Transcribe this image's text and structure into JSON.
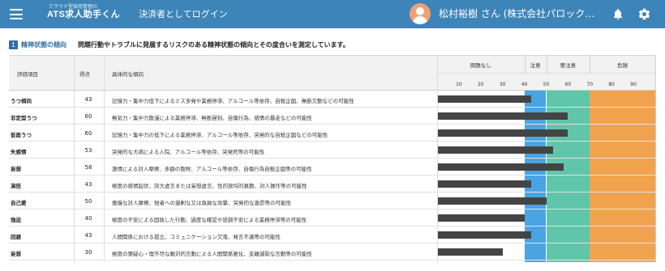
{
  "header": {
    "brand_sub": "クラウド型採用管理の",
    "brand_main": "ATS求人助手くん",
    "login_as": "決済者としてログイン",
    "user_name": "松村裕樹 さん (株式会社パロックワークス)",
    "colors": {
      "bar_bg": "#3d84b8",
      "avatar": "#f0a070"
    },
    "icons": [
      "menu-icon",
      "avatar-icon",
      "bell-icon",
      "gear-icon"
    ]
  },
  "section": {
    "number": "1",
    "title": "精神状態の傾向",
    "description": "問題行動やトラブルに発展するリスクのある精神状態の傾向とその度合いを測定しています。"
  },
  "table": {
    "columns": {
      "item": "評価項目",
      "score": "得点",
      "trend": "具体的な傾向"
    },
    "zones": [
      {
        "label": "問題なし",
        "from": 0,
        "to": 40,
        "color": "#ffffff"
      },
      {
        "label": "注意",
        "from": 40,
        "to": 50,
        "color": "#4aa3e3"
      },
      {
        "label": "要注意",
        "from": 50,
        "to": 70,
        "color": "#5fc6aa"
      },
      {
        "label": "危険",
        "from": 70,
        "to": 100,
        "color": "#f0a34c"
      }
    ],
    "ticks": [
      "10",
      "20",
      "30",
      "40",
      "50",
      "60",
      "70",
      "80",
      "90"
    ],
    "rows": [
      {
        "item": "うつ傾向",
        "score": "43",
        "value": 43,
        "trend": "記憶力・集中力低下によるミス多発や業務停滞、アルコール等依存、自殺企図、無断欠勤などの可能性"
      },
      {
        "item": "非定型うつ",
        "score": "60",
        "value": 60,
        "trend": "無気力・集中力散漫による業務停滞、無断遅刻、自傷行為、感情の暴走などの可能性"
      },
      {
        "item": "仮面うつ",
        "score": "60",
        "value": 60,
        "trend": "記憶力・集中力の低下による業務停滞、アルコール等依存、突発的な自殺企図などの可能性"
      },
      {
        "item": "失感情",
        "score": "53",
        "value": 53,
        "trend": "突発的な大病による入院、アルコール等依存、突発死等の可能性"
      },
      {
        "item": "妄想",
        "score": "58",
        "value": 58,
        "trend": "激情による対人摩擦、多額の散財、アルコール等依存、自傷行為自殺企図等の可能性"
      },
      {
        "item": "演技",
        "score": "43",
        "value": 43,
        "trend": "極度の感情起伏、誇大虚言または妄想虚言、性的放埒的異動、対人操作等の可能性"
      },
      {
        "item": "自己愛",
        "score": "50",
        "value": 50,
        "trend": "傲慢な対人摩擦、他者への過剰な又は執拗な攻撃、突発的な激昂等の可能性"
      },
      {
        "item": "強迫",
        "score": "40",
        "value": 40,
        "trend": "極度の不安による固執した行動、過度な確認や語調不安による業務停滞等の可能性"
      },
      {
        "item": "回避",
        "score": "43",
        "value": 43,
        "trend": "人間関係における孤立、コミュニケーション欠落、発言不適等の可能性"
      },
      {
        "item": "妄想",
        "score": "30",
        "value": 30,
        "trend": "極度の猜疑心・理不尽な敵対的言動による人間関係悪化、支離滅裂な言動等の可能性"
      }
    ]
  }
}
